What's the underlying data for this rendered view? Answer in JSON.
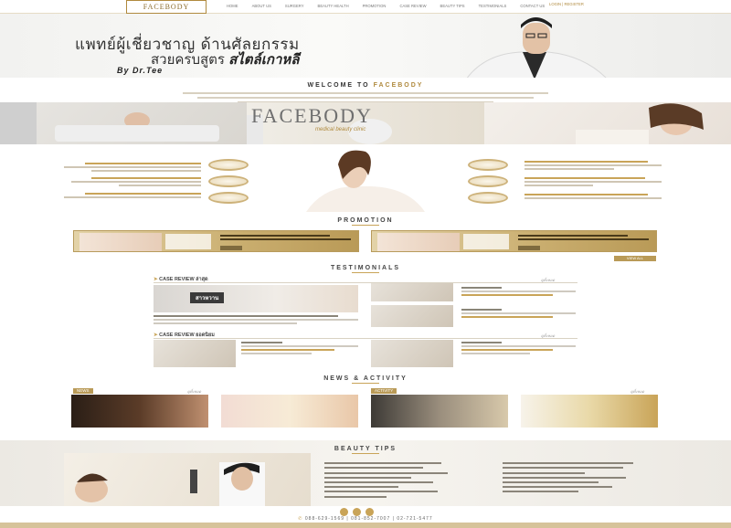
{
  "header": {
    "logo": "FACEBODY",
    "login": "LOGIN | REGISTER",
    "nav": [
      "HOME",
      "ABOUT US",
      "SURGERY",
      "BEAUTY HEALTH",
      "PROMOTION",
      "CASE REVIEW",
      "BEAUTY TIPS",
      "TESTIMONIALS",
      "CONTACT US"
    ]
  },
  "hero": {
    "line1": "แพทย์ผู้เชี่ยวชาญ ด้านศัลยกรรม",
    "line2_prefix": "สวยครบสูตร",
    "line2_bold": "สไตล์เกาหลี",
    "byline": "By Dr.Tee"
  },
  "welcome": {
    "prefix": "WELCOME TO ",
    "brand": "FACEBODY"
  },
  "banner": {
    "brand": "FACEBODY",
    "sub": "medical beauty clinic"
  },
  "sections": {
    "promotion": "PROMOTION",
    "testimonials": "TESTIMONIALS",
    "news_activity": "NEWS & ACTIVITY",
    "beauty_tips": "BEAUTY TIPS"
  },
  "promotion": {
    "view_all": "VIEW ALL"
  },
  "case_review": {
    "heading_1": "CASE REVIEW ล่าสุด",
    "heading_2": "CASE REVIEW ยอดนิยม",
    "overlay": "สาวหวาน",
    "read_more": "ดูทั้งหมด"
  },
  "news": {
    "tag_news": "NEWS",
    "tag_activity": "ACTIVITY",
    "read_more": "ดูทั้งหมด"
  },
  "footer": {
    "phones": "088-629-1569  |  081-852-7007  |  02-721-5477"
  },
  "colors": {
    "gold": "#c9a458",
    "gold_dark": "#b08a3e",
    "text": "#555555"
  }
}
